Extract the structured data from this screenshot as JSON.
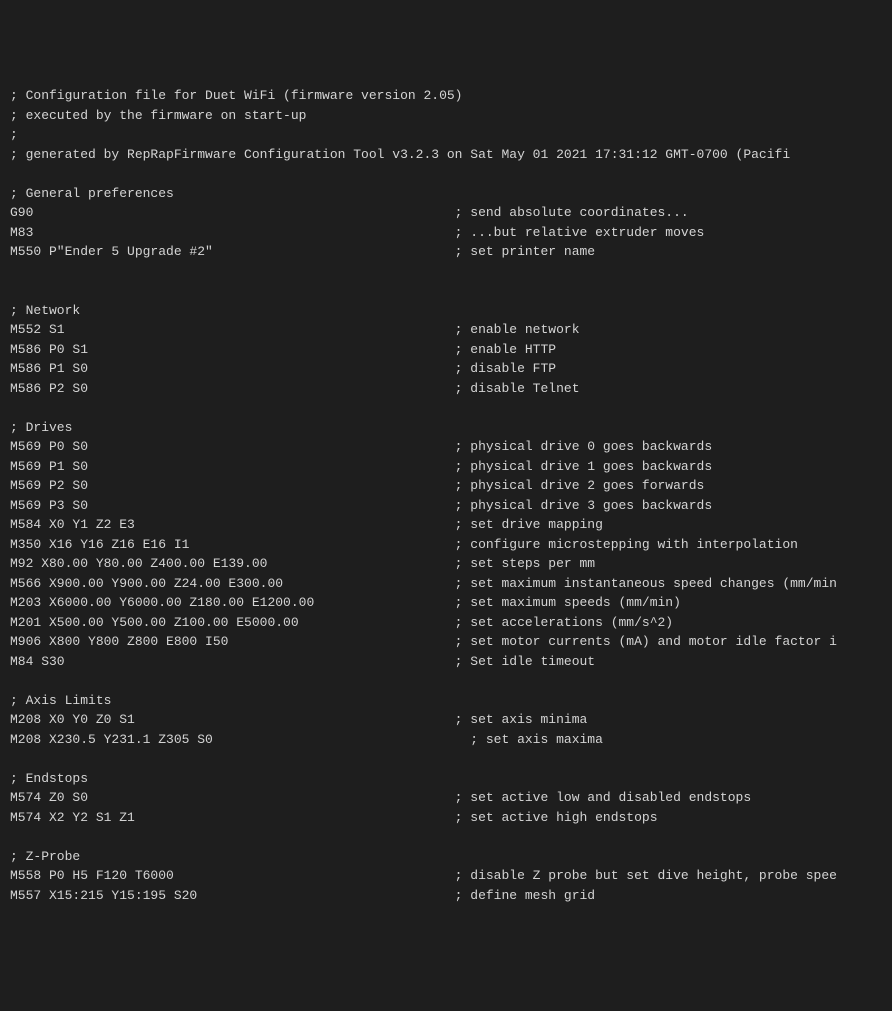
{
  "lines": [
    "; Configuration file for Duet WiFi (firmware version 2.05)",
    "; executed by the firmware on start-up",
    ";",
    "; generated by RepRapFirmware Configuration Tool v3.2.3 on Sat May 01 2021 17:31:12 GMT-0700 (Pacifi",
    "",
    "; General preferences",
    "G90                                                      ; send absolute coordinates...",
    "M83                                                      ; ...but relative extruder moves",
    "M550 P\"Ender 5 Upgrade #2\"                               ; set printer name",
    "",
    "",
    "; Network",
    "M552 S1                                                  ; enable network",
    "M586 P0 S1                                               ; enable HTTP",
    "M586 P1 S0                                               ; disable FTP",
    "M586 P2 S0                                               ; disable Telnet",
    "",
    "; Drives",
    "M569 P0 S0                                               ; physical drive 0 goes backwards",
    "M569 P1 S0                                               ; physical drive 1 goes backwards",
    "M569 P2 S0                                               ; physical drive 2 goes forwards",
    "M569 P3 S0                                               ; physical drive 3 goes backwards",
    "M584 X0 Y1 Z2 E3                                         ; set drive mapping",
    "M350 X16 Y16 Z16 E16 I1                                  ; configure microstepping with interpolation",
    "M92 X80.00 Y80.00 Z400.00 E139.00                        ; set steps per mm",
    "M566 X900.00 Y900.00 Z24.00 E300.00                      ; set maximum instantaneous speed changes (mm/min",
    "M203 X6000.00 Y6000.00 Z180.00 E1200.00                  ; set maximum speeds (mm/min)",
    "M201 X500.00 Y500.00 Z100.00 E5000.00                    ; set accelerations (mm/s^2)",
    "M906 X800 Y800 Z800 E800 I50                             ; set motor currents (mA) and motor idle factor i",
    "M84 S30                                                  ; Set idle timeout",
    "",
    "; Axis Limits",
    "M208 X0 Y0 Z0 S1                                         ; set axis minima",
    "M208 X230.5 Y231.1 Z305 S0                                 ; set axis maxima",
    "",
    "; Endstops",
    "M574 Z0 S0                                               ; set active low and disabled endstops",
    "M574 X2 Y2 S1 Z1                                         ; set active high endstops",
    "",
    "; Z-Probe",
    "M558 P0 H5 F120 T6000                                    ; disable Z probe but set dive height, probe spee",
    "M557 X15:215 Y15:195 S20                                 ; define mesh grid"
  ]
}
